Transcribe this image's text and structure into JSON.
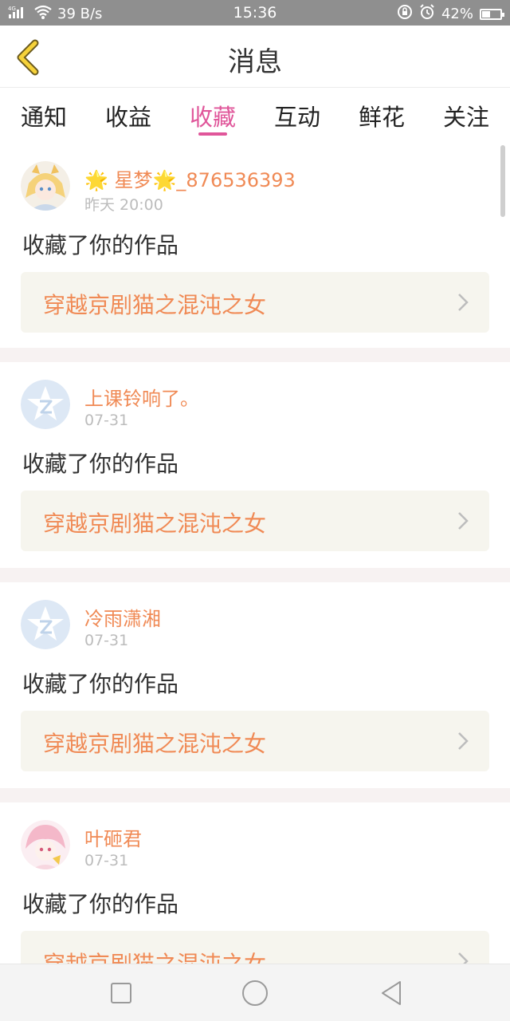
{
  "status_bar": {
    "network": "4G",
    "speed": "39 B/s",
    "time": "15:36",
    "battery": "42%",
    "battery_level": 0.42,
    "icons": [
      "signal-icon",
      "wifi-icon",
      "rotation-lock-icon",
      "alarm-icon",
      "battery-icon"
    ]
  },
  "header": {
    "title": "消息",
    "back_icon": "back-chevron-icon"
  },
  "tabs": [
    {
      "label": "通知",
      "active": false
    },
    {
      "label": "收益",
      "active": false
    },
    {
      "label": "收藏",
      "active": true
    },
    {
      "label": "互动",
      "active": false
    },
    {
      "label": "鲜花",
      "active": false
    },
    {
      "label": "关注",
      "active": false
    }
  ],
  "accent_color": "#e0569a",
  "name_color": "#f08a55",
  "messages": [
    {
      "avatar": "anime-avatar",
      "username_prefix": "🌟 ",
      "username": "星梦",
      "username_suffix": "🌟_876536393",
      "time": "昨天 20:00",
      "action": "收藏了你的作品",
      "work_title": "穿越京剧猫之混沌之女"
    },
    {
      "avatar": "default-star-avatar",
      "username_prefix": "",
      "username": "上课铃响了。",
      "username_suffix": "",
      "time": "07-31",
      "action": "收藏了你的作品",
      "work_title": "穿越京剧猫之混沌之女"
    },
    {
      "avatar": "default-star-avatar",
      "username_prefix": "",
      "username": "冷雨潇湘",
      "username_suffix": "",
      "time": "07-31",
      "action": "收藏了你的作品",
      "work_title": "穿越京剧猫之混沌之女"
    },
    {
      "avatar": "anime-avatar",
      "username_prefix": "",
      "username": "叶砸君",
      "username_suffix": "",
      "time": "07-31",
      "action": "收藏了你的作品",
      "work_title": "穿越京剧猫之混沌之女"
    }
  ],
  "system_nav": [
    "recent-apps-icon",
    "home-icon",
    "back-triangle-icon"
  ]
}
